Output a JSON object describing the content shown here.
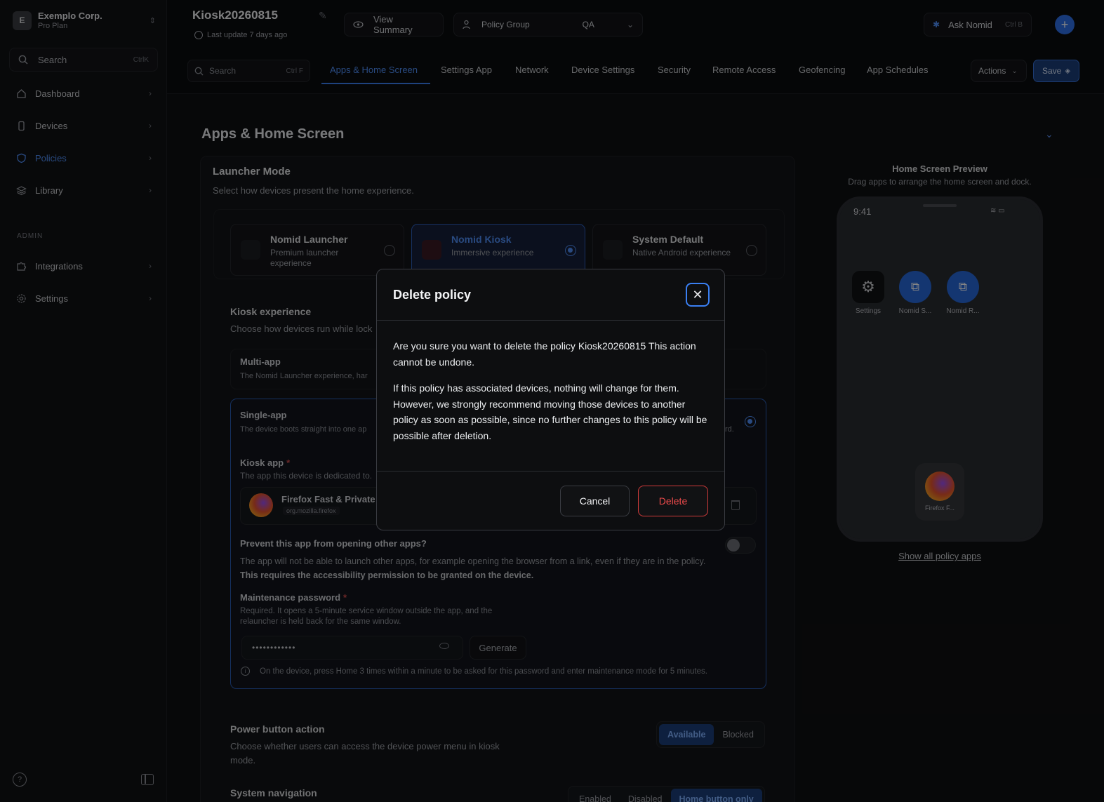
{
  "sidebar": {
    "org_initial": "E",
    "org_name": "Exemplo Corp.",
    "org_plan": "Pro Plan",
    "search_label": "Search",
    "search_shortcut": "CtrlK",
    "items": [
      {
        "label": "Dashboard",
        "icon": "home-icon"
      },
      {
        "label": "Devices",
        "icon": "phone-icon"
      },
      {
        "label": "Policies",
        "icon": "shield-icon",
        "active": true
      },
      {
        "label": "Library",
        "icon": "layers-icon"
      }
    ],
    "admin_label": "ADMIN",
    "admin_items": [
      {
        "label": "Integrations",
        "icon": "puzzle-icon"
      },
      {
        "label": "Settings",
        "icon": "gear-icon"
      }
    ]
  },
  "header": {
    "policy_title": "Kiosk20260815",
    "last_update": "Last update 7 days ago",
    "view_summary": "View Summary",
    "policy_group_label": "Policy Group",
    "policy_group_value": "QA",
    "ask_label": "Ask Nomid",
    "ask_shortcut": "Ctrl B"
  },
  "tabs": {
    "search_label": "Search",
    "search_shortcut": "Ctrl F",
    "items": [
      "Apps & Home Screen",
      "Settings App",
      "Network",
      "Device Settings",
      "Security",
      "Remote Access",
      "Geofencing",
      "App Schedules"
    ],
    "actions_label": "Actions",
    "save_label": "Save"
  },
  "main": {
    "section_title": "Apps & Home Screen",
    "launcher_title": "Launcher Mode",
    "launcher_sub": "Select how devices present the home experience.",
    "launcher_options": [
      {
        "title": "Nomid Launcher",
        "sub": "Premium launcher experience"
      },
      {
        "title": "Nomid Kiosk",
        "sub": "Immersive experience"
      },
      {
        "title": "System Default",
        "sub": "Native Android experience"
      }
    ],
    "kiosk_title": "Kiosk experience",
    "kiosk_sub": "Choose how devices run while lock",
    "multi_title": "Multi-app",
    "multi_sub": "The Nomid Launcher experience, har",
    "single_title": "Single-app",
    "single_sub": "The device boots straight into one ap",
    "single_sub_end": "rd.",
    "kiosk_app_title": "Kiosk app",
    "kiosk_app_req": "*",
    "kiosk_app_sub": "The app this device is dedicated to.",
    "app_name": "Firefox Fast & Private",
    "app_pkg": "org.mozilla.firefox",
    "prevent_title": "Prevent this app from opening other apps?",
    "prevent_sub": "The app will not be able to launch other apps, for example opening the browser from a link, even if they are in the policy.",
    "prevent_bold": "This requires the accessibility permission to be granted on the device.",
    "mp_title": "Maintenance password",
    "mp_req": "*",
    "mp_sub": "Required. It opens a 5-minute service window outside the app, and the relauncher is held back for the same window.",
    "password_mask": "••••••••••••",
    "generate_label": "Generate",
    "info_text": "On the device, press Home 3 times within a minute to be asked for this password and enter maintenance mode for 5 minutes.",
    "power_title": "Power button action",
    "power_sub": "Choose whether users can access the device power menu in kiosk mode.",
    "power_options": [
      "Available",
      "Blocked"
    ],
    "sysnav_title": "System navigation",
    "sysnav_options": [
      "Enabled",
      "Disabled",
      "Home button only"
    ]
  },
  "preview": {
    "title": "Home Screen Preview",
    "sub": "Drag apps to arrange the home screen and dock.",
    "time": "9:41",
    "apps": [
      "Settings",
      "Nomid S...",
      "Nomid R..."
    ],
    "dock_app": "Firefox F...",
    "show_all": "Show all policy apps"
  },
  "modal": {
    "title": "Delete policy",
    "p1": "Are you sure you want to delete the policy Kiosk20260815 This action cannot be undone.",
    "p2": "If this policy has associated devices, nothing will change for them. However, we strongly recommend moving those devices to another policy as soon as possible, since no further changes to this policy will be possible after deletion.",
    "cancel": "Cancel",
    "delete": "Delete"
  },
  "colors": {
    "accent": "#3a7ff2",
    "danger": "#ef4b4b",
    "background": "#0b0c0e"
  }
}
